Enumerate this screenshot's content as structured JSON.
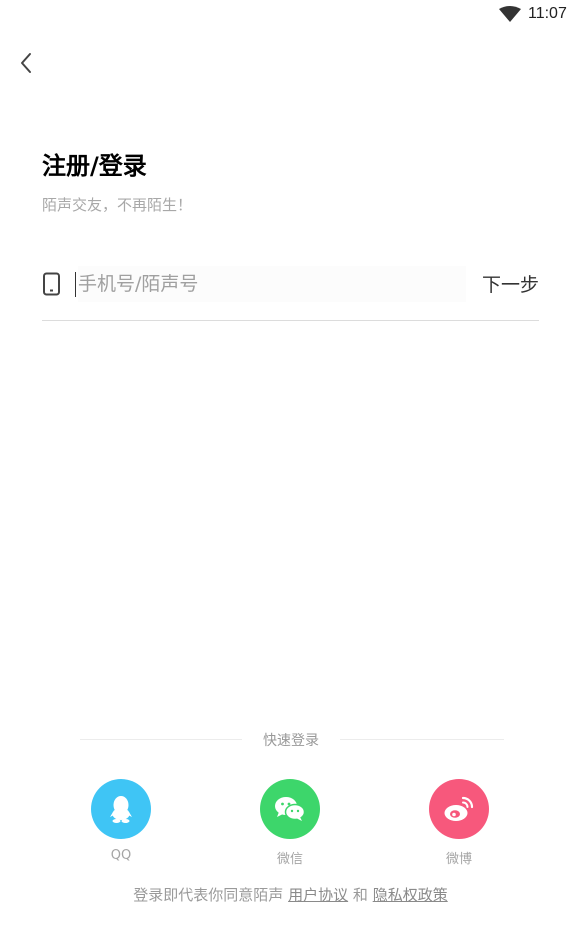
{
  "status_bar": {
    "time": "11:07"
  },
  "header": {
    "title": "注册/登录",
    "subtitle": "陌声交友，不再陌生！"
  },
  "login_form": {
    "phone_placeholder": "手机号/陌声号",
    "next_label": "下一步"
  },
  "quick_login": {
    "title": "快速登录",
    "providers": [
      {
        "label": "QQ",
        "color": "#3fc5f5",
        "icon": "qq-icon"
      },
      {
        "label": "微信",
        "color": "#3dd66b",
        "icon": "wechat-icon"
      },
      {
        "label": "微博",
        "color": "#f7587c",
        "icon": "weibo-icon"
      }
    ]
  },
  "agreement": {
    "prefix": "登录即代表你同意陌声",
    "user_agreement": "用户协议",
    "and": "和",
    "privacy_policy": "隐私权政策"
  }
}
